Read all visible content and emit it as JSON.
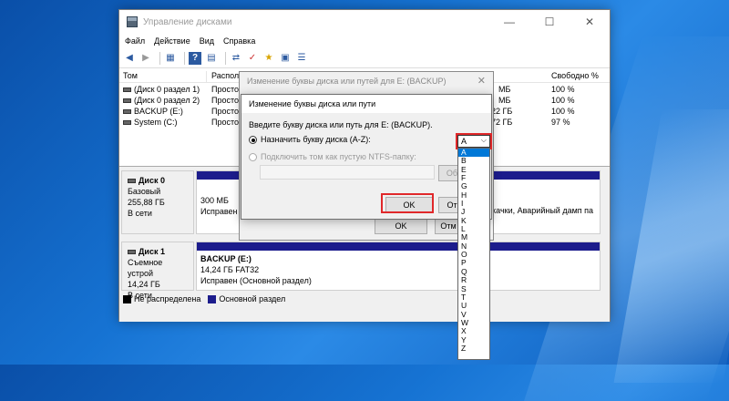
{
  "window": {
    "title": "Управление дисками",
    "controls": [
      "—",
      "☐",
      "✕"
    ]
  },
  "menu": [
    "Файл",
    "Действие",
    "Вид",
    "Справка"
  ],
  "volumes": {
    "headers": [
      "Том",
      "Располо",
      "Свободно %"
    ],
    "rows": [
      {
        "name": "(Диск 0 раздел 1)",
        "layout": "Просто",
        "free": "МБ",
        "pct": "100 %"
      },
      {
        "name": "(Диск 0 раздел 2)",
        "layout": "Просто",
        "free": "МБ",
        "pct": "100 %"
      },
      {
        "name": "BACKUP (E:)",
        "layout": "Просто",
        "free": "22 ГБ",
        "pct": "100 %"
      },
      {
        "name": "System (C:)",
        "layout": "Просто",
        "free": "72 ГБ",
        "pct": "97 %"
      }
    ]
  },
  "disks": [
    {
      "name": "Диск 0",
      "type": "Базовый",
      "size": "255,88 ГБ",
      "status": "В сети",
      "part_size": "300 МБ",
      "part_status": "Исправен",
      "part_right": "качки, Аварийный дамп па"
    },
    {
      "name": "Диск 1",
      "type": "Съемное устрой",
      "size": "14,24 ГБ",
      "status": "В сети",
      "part_label": "BACKUP  (E:)",
      "part_size": "14,24 ГБ FAT32",
      "part_status": "Исправен (Основной раздел)"
    }
  ],
  "legend": {
    "unallocated": "Не распределена",
    "primary": "Основной раздел"
  },
  "dialog_back": {
    "title": "Изменение буквы диска или путей для E: (BACKUP)",
    "ok": "OK",
    "cancel": "Отм"
  },
  "dialog_front": {
    "title": "Изменение буквы диска или пути",
    "prompt": "Введите букву диска или путь для E: (BACKUP).",
    "radio_assign": "Назначить букву диска (A-Z):",
    "radio_mount": "Подключить том как пустую NTFS-папку:",
    "browse": "Об",
    "ok": "OK",
    "cancel": "От"
  },
  "dropdown": {
    "selected": "A",
    "options": [
      "A",
      "B",
      "E",
      "F",
      "G",
      "H",
      "I",
      "J",
      "K",
      "L",
      "M",
      "N",
      "O",
      "P",
      "Q",
      "R",
      "S",
      "T",
      "U",
      "V",
      "W",
      "X",
      "Y",
      "Z"
    ]
  },
  "colors": {
    "highlight": "#e0282a",
    "primary_partition": "#1c1c8c",
    "selection": "#0078d7"
  }
}
